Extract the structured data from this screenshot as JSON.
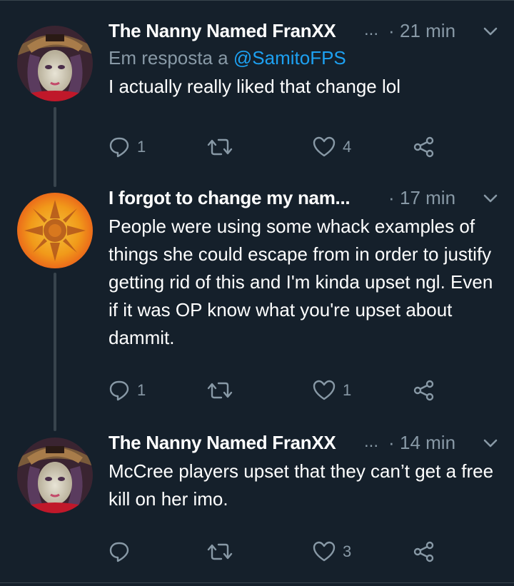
{
  "tweets": [
    {
      "author": "The Nanny Named FranXX",
      "truncation": "...",
      "separator": "·",
      "time": "21 min",
      "reply_prefix": "Em resposta a",
      "reply_handle": "@SamitoFPS",
      "text": "I actually really liked that change lol",
      "avatar": "anime-cowboy-avatar",
      "replies": "1",
      "retweets": "",
      "likes": "4"
    },
    {
      "author": "I forgot to change my nam...",
      "separator": "·",
      "time": "17 min",
      "text": "People were using some whack examples of things she could escape from in order to justify getting rid of this and I'm kinda upset ngl. Even if it was OP know what you're upset about dammit.",
      "avatar": "sun-emblem-avatar",
      "replies": "1",
      "retweets": "",
      "likes": "1"
    },
    {
      "author": "The Nanny Named FranXX",
      "truncation": "...",
      "separator": "·",
      "time": "14 min",
      "text": "McCree players upset that they can’t get a free kill on her imo.",
      "avatar": "anime-cowboy-avatar",
      "replies": "",
      "retweets": "",
      "likes": "3"
    }
  ],
  "colors": {
    "background": "#15202b",
    "secondary_text": "#8899a6",
    "link": "#1da1f2",
    "divider": "#38444d"
  },
  "icons": [
    "reply-icon",
    "retweet-icon",
    "like-icon",
    "share-icon",
    "chevron-down-icon"
  ]
}
